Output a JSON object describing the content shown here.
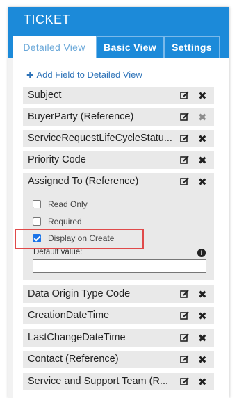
{
  "panel": {
    "title": "TICKET"
  },
  "tabs": [
    {
      "label": "Detailed View",
      "active": true
    },
    {
      "label": "Basic View",
      "active": false
    },
    {
      "label": "Settings",
      "active": false
    }
  ],
  "add_field": {
    "label": "Add Field to Detailed View",
    "icon": "plus-icon"
  },
  "fields": [
    {
      "label": "Subject"
    },
    {
      "label": "BuyerParty (Reference)",
      "delete_disabled": true
    },
    {
      "label": "ServiceRequestLifeCycleStatu..."
    },
    {
      "label": "Priority Code"
    },
    {
      "label": "Assigned To (Reference)",
      "expanded": true
    },
    {
      "label": "Data Origin Type Code"
    },
    {
      "label": "CreationDateTime"
    },
    {
      "label": "LastChangeDateTime"
    },
    {
      "label": "Contact (Reference)"
    },
    {
      "label": "Service and Support Team (R..."
    }
  ],
  "field_options": {
    "read_only": {
      "label": "Read Only",
      "checked": false
    },
    "required": {
      "label": "Required",
      "checked": false
    },
    "display_on_create": {
      "label": "Display on Create",
      "checked": true
    },
    "default_value_label": "Default value:",
    "default_value": ""
  },
  "colors": {
    "header": "#1c8ad9",
    "link": "#2e73b8",
    "highlight": "#e04a4a",
    "checkbox": "#1a73e8"
  }
}
